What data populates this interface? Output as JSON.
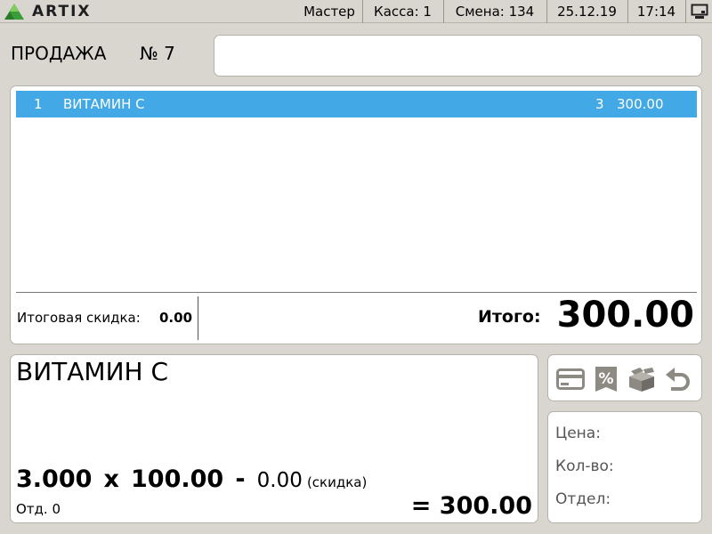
{
  "app": {
    "logo_text": "ARTIX"
  },
  "status_bar": {
    "user": "Мастер",
    "register": "Касса: 1",
    "shift": "Смена: 134",
    "date": "25.12.19",
    "time": "17:14"
  },
  "sale": {
    "title": "ПРОДАЖА",
    "number": "№ 7",
    "scan_placeholder": ""
  },
  "receipt": {
    "items": [
      {
        "index": "1",
        "name": "ВИТАМИН С",
        "qty": "3",
        "sum": "300.00"
      }
    ],
    "discount_label": "Итоговая скидка:",
    "discount_value": "0.00",
    "total_label": "Итого:",
    "total_value": "300.00"
  },
  "detail": {
    "name": "ВИТАМИН С",
    "qty": "3.000",
    "times": "x",
    "price": "100.00",
    "minus": "-",
    "discount": "0.00",
    "discount_note": "(скидка)",
    "department": "Отд. 0",
    "total": "= 300.00"
  },
  "info": {
    "price_label": "Цена:",
    "qty_label": "Кол-во:",
    "dept_label": "Отдел:"
  },
  "icons": {
    "payment": "card-icon",
    "discount": "percent-tag-icon",
    "products": "boxes-icon",
    "return": "undo-icon",
    "terminal": "monitor-icon"
  },
  "colors": {
    "selection": "#42a9e6",
    "background": "#d9d6d0",
    "icon_gray": "#8d8a84",
    "logo_green": "#3a9d3a"
  }
}
